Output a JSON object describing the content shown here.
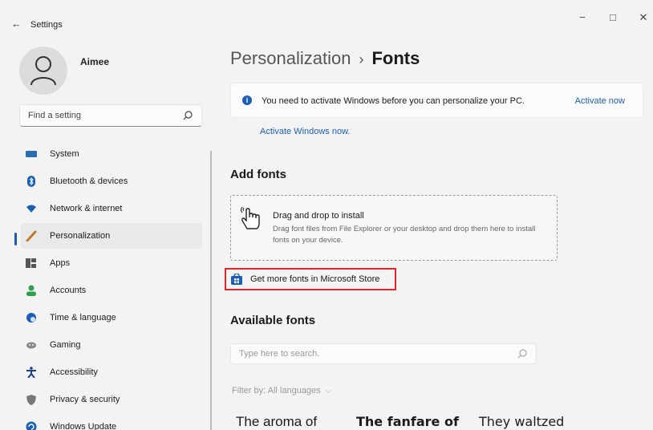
{
  "app": {
    "title": "Settings",
    "back": "←"
  },
  "window": {
    "minimize": "−",
    "maximize": "□",
    "close": "✕"
  },
  "user": {
    "name": "Aimee"
  },
  "search": {
    "placeholder": "Find a setting"
  },
  "nav": [
    {
      "label": "System",
      "icon": "monitor-icon",
      "color": "#2b6cb0"
    },
    {
      "label": "Bluetooth & devices",
      "icon": "bluetooth-icon",
      "color": "#1a5fb4"
    },
    {
      "label": "Network & internet",
      "icon": "wifi-icon",
      "color": "#1a5fb4"
    },
    {
      "label": "Personalization",
      "icon": "brush-icon",
      "color": "#c07a2c",
      "active": true
    },
    {
      "label": "Apps",
      "icon": "apps-icon",
      "color": "#555555"
    },
    {
      "label": "Accounts",
      "icon": "person-icon",
      "color": "#2e9e4f"
    },
    {
      "label": "Time & language",
      "icon": "globe-clock-icon",
      "color": "#1a5fb4"
    },
    {
      "label": "Gaming",
      "icon": "controller-icon",
      "color": "#888888"
    },
    {
      "label": "Accessibility",
      "icon": "accessibility-icon",
      "color": "#1a3f8a"
    },
    {
      "label": "Privacy & security",
      "icon": "shield-icon",
      "color": "#777777"
    },
    {
      "label": "Windows Update",
      "icon": "update-icon",
      "color": "#1a5fb4"
    }
  ],
  "breadcrumb": {
    "parent": "Personalization",
    "separator": "›",
    "current": "Fonts"
  },
  "banner": {
    "message": "You need to activate Windows before you can personalize your PC.",
    "action": "Activate now"
  },
  "activate_link": "Activate Windows now.",
  "add_fonts": {
    "heading": "Add fonts",
    "drop_title": "Drag and drop to install",
    "drop_desc": "Drag font files from File Explorer or your desktop and drop them here to install fonts on your device.",
    "store_link": "Get more fonts in Microsoft Store"
  },
  "available_fonts": {
    "heading": "Available fonts",
    "search_placeholder": "Type here to search.",
    "filter": "Filter by: All languages"
  },
  "previews": [
    "The aroma of",
    "The fanfare of",
    "They waltzed"
  ],
  "colors": {
    "accent": "#1a5fb4",
    "highlight": "#e0262d"
  }
}
